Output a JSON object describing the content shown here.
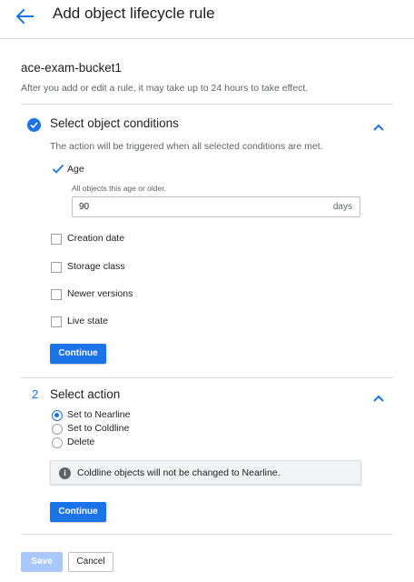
{
  "header": {
    "title": "Add object lifecycle rule",
    "back_icon": "arrow-back-icon"
  },
  "bucket": {
    "name": "ace-exam-bucket1",
    "info": "After you add or edit a rule, it may take up to 24 hours to take effect."
  },
  "step1": {
    "title": "Select object conditions",
    "status": "completed",
    "description": "The action will be triggered when all selected conditions are met.",
    "conditions": [
      {
        "label": "Age",
        "checked": true
      },
      {
        "label": "Creation date",
        "checked": false
      },
      {
        "label": "Storage class",
        "checked": false
      },
      {
        "label": "Newer versions",
        "checked": false
      },
      {
        "label": "Live state",
        "checked": false
      }
    ],
    "age": {
      "hint": "All objects this age or older.",
      "value": "90",
      "unit": "days"
    },
    "continue_label": "Continue"
  },
  "step2": {
    "number": "2",
    "title": "Select action",
    "actions": [
      {
        "label": "Set to Nearline",
        "selected": true
      },
      {
        "label": "Set to Coldline",
        "selected": false
      },
      {
        "label": "Delete",
        "selected": false
      }
    ],
    "notice": "Coldline objects will not be changed to Nearline.",
    "continue_label": "Continue"
  },
  "footer": {
    "save_label": "Save",
    "save_disabled": true,
    "cancel_label": "Cancel"
  },
  "colors": {
    "accent": "#1a73e8",
    "disabled_button": "#a8c7fa"
  }
}
